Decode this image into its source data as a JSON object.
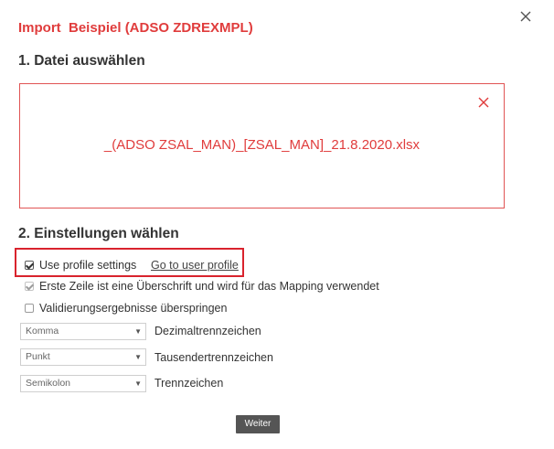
{
  "dialog": {
    "title": "Import  Beispiel (ADSO ZDREXMPL)",
    "close_icon": "close-icon"
  },
  "step1": {
    "heading": "1. Datei auswählen",
    "filename": "_(ADSO ZSAL_MAN)_[ZSAL_MAN]_21.8.2020.xlsx",
    "remove_icon": "close-icon"
  },
  "step2": {
    "heading": "2. Einstellungen wählen",
    "use_profile": {
      "label": "Use profile settings",
      "checked": true
    },
    "profile_link": "Go to user profile",
    "first_row_header": {
      "label": "Erste Zeile ist eine Überschrift und wird für das Mapping verwendet",
      "checked": true,
      "disabled": true
    },
    "skip_validation": {
      "label": "Validierungsergebnisse überspringen",
      "checked": false
    },
    "decimal": {
      "value": "Komma",
      "label": "Dezimaltrennzeichen"
    },
    "thousands": {
      "value": "Punkt",
      "label": "Tausendertrennzeichen"
    },
    "separator": {
      "value": "Semikolon",
      "label": "Trennzeichen"
    }
  },
  "footer": {
    "next_label": "Weiter"
  },
  "colors": {
    "accent": "#e03c3c",
    "highlight_border": "#d9232d",
    "button_bg": "#555555"
  }
}
